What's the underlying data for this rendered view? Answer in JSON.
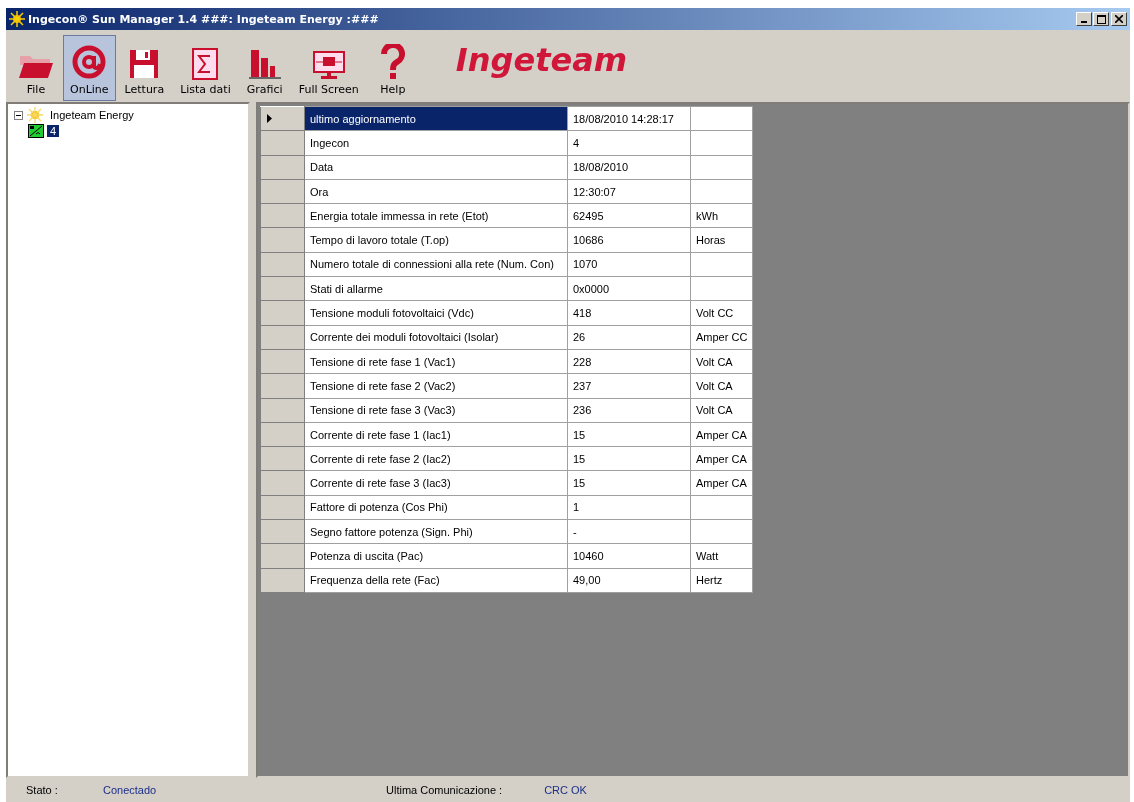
{
  "window": {
    "title": "Ingecon® Sun Manager 1.4 ###: Ingeteam Energy :###"
  },
  "toolbar": [
    {
      "kind": "folder",
      "label": "File",
      "selected": false
    },
    {
      "kind": "at",
      "label": "OnLine",
      "selected": true
    },
    {
      "kind": "disk",
      "label": "Lettura",
      "selected": false
    },
    {
      "kind": "sigma",
      "label": "Lista dati",
      "selected": false
    },
    {
      "kind": "bars",
      "label": "Grafici",
      "selected": false
    },
    {
      "kind": "screen",
      "label": "Full Screen",
      "selected": false
    },
    {
      "kind": "help",
      "label": "Help",
      "selected": false
    }
  ],
  "logo": "Ingeteam",
  "tree": [
    {
      "label": "Ingeteam Energy",
      "expanded": true,
      "selected": false,
      "children": [
        {
          "label": "4",
          "selected": true
        }
      ]
    }
  ],
  "table": {
    "rows": [
      {
        "name": "ultimo aggiornamento",
        "value": "18/08/2010 14:28:17",
        "unit": "",
        "selected": true
      },
      {
        "name": "Ingecon",
        "value": "4",
        "unit": "",
        "selected": false
      },
      {
        "name": "Data",
        "value": "18/08/2010",
        "unit": "",
        "selected": false
      },
      {
        "name": "Ora",
        "value": "12:30:07",
        "unit": "",
        "selected": false
      },
      {
        "name": "Energia totale immessa in rete (Etot)",
        "value": "62495",
        "unit": "kWh",
        "selected": false
      },
      {
        "name": "Tempo di lavoro totale (T.op)",
        "value": "10686",
        "unit": "Horas",
        "selected": false
      },
      {
        "name": "Numero totale di connessioni alla rete (Num. Con)",
        "value": "1070",
        "unit": "",
        "selected": false
      },
      {
        "name": "Stati di allarme",
        "value": "0x0000",
        "unit": "",
        "selected": false
      },
      {
        "name": "Tensione moduli fotovoltaici (Vdc)",
        "value": "418",
        "unit": "Volt CC",
        "selected": false
      },
      {
        "name": "Corrente dei moduli fotovoltaici (Isolar)",
        "value": "26",
        "unit": "Amper CC",
        "selected": false
      },
      {
        "name": "Tensione di rete fase 1 (Vac1)",
        "value": "228",
        "unit": "Volt CA",
        "selected": false
      },
      {
        "name": "Tensione di rete fase 2 (Vac2)",
        "value": "237",
        "unit": "Volt CA",
        "selected": false
      },
      {
        "name": "Tensione di rete fase 3 (Vac3)",
        "value": "236",
        "unit": "Volt CA",
        "selected": false
      },
      {
        "name": "Corrente di rete fase 1 (Iac1)",
        "value": "15",
        "unit": "Amper CA",
        "selected": false
      },
      {
        "name": "Corrente di rete fase 2 (Iac2)",
        "value": "15",
        "unit": "Amper CA",
        "selected": false
      },
      {
        "name": "Corrente di rete fase 3 (Iac3)",
        "value": "15",
        "unit": "Amper CA",
        "selected": false
      },
      {
        "name": "Fattore di potenza (Cos Phi)",
        "value": "1",
        "unit": "",
        "selected": false
      },
      {
        "name": "Segno fattore potenza (Sign. Phi)",
        "value": "-",
        "unit": "",
        "selected": false
      },
      {
        "name": "Potenza di uscita (Pac)",
        "value": "10460",
        "unit": "Watt",
        "selected": false
      },
      {
        "name": "Frequenza della rete (Fac)",
        "value": "49,00",
        "unit": "Hertz",
        "selected": false
      }
    ]
  },
  "status_bar": [
    {
      "label": "Stato :",
      "value": "Conectado"
    },
    {
      "label": "Ultima Comunicazione :",
      "value": "CRC OK"
    }
  ]
}
